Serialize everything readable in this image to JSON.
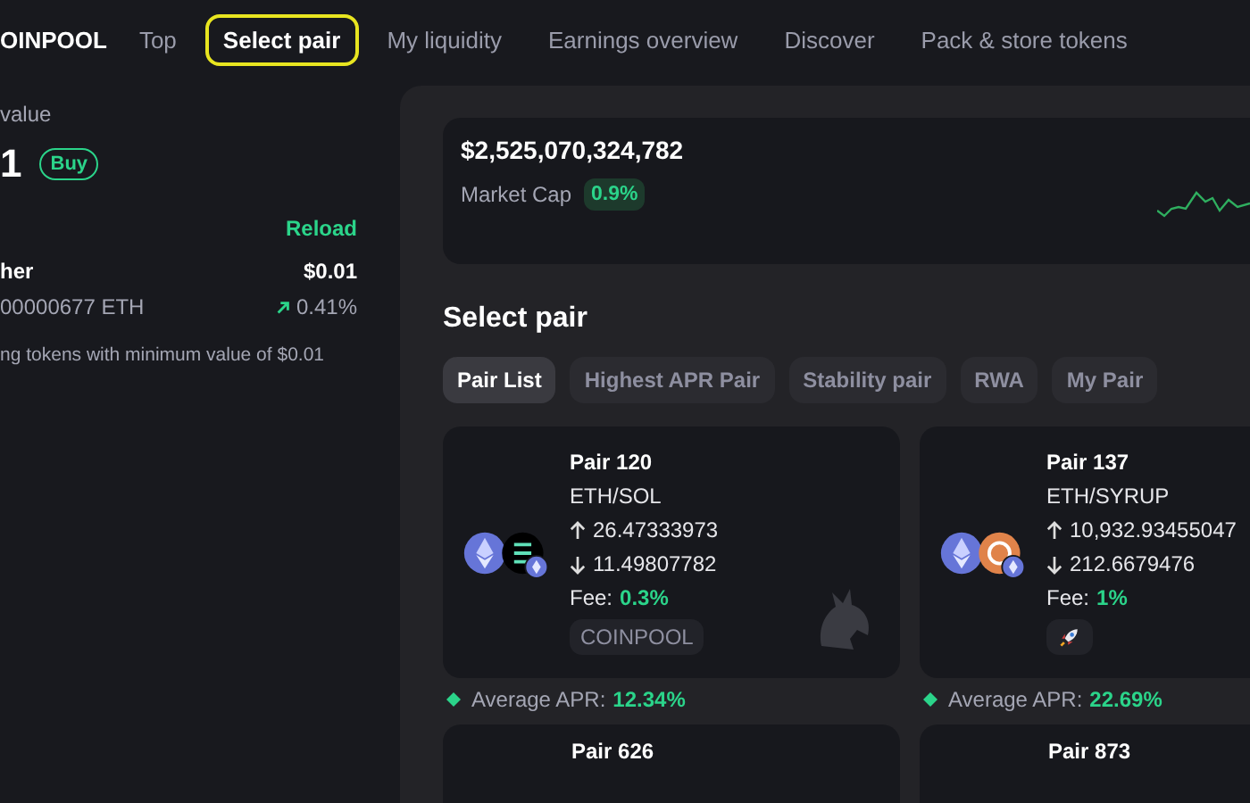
{
  "nav": {
    "logo": "OINPOOL",
    "items": [
      {
        "label": "Top",
        "selected": false
      },
      {
        "label": "Select pair",
        "selected": true
      },
      {
        "label": "My liquidity",
        "selected": false
      },
      {
        "label": "Earnings overview",
        "selected": false
      },
      {
        "label": "Discover",
        "selected": false
      },
      {
        "label": "Pack & store tokens",
        "selected": false
      }
    ]
  },
  "wallet": {
    "label": "value",
    "amount": "1",
    "buy": "Buy",
    "reload": "Reload",
    "token_name": "her",
    "price": "$0.01",
    "balance": "00000677 ETH",
    "change": "0.41%",
    "note": "ng tokens with minimum value of $0.01"
  },
  "market": {
    "value": "$2,525,070,324,782",
    "label": "Market Cap",
    "change": "0.9%"
  },
  "section_title": "Select pair",
  "filters": [
    {
      "label": "Pair List",
      "selected": true
    },
    {
      "label": "Highest APR Pair",
      "selected": false
    },
    {
      "label": "Stability pair",
      "selected": false
    },
    {
      "label": "RWA",
      "selected": false
    },
    {
      "label": "My Pair",
      "selected": false
    }
  ],
  "pairs": [
    {
      "name": "Pair 120",
      "symbol": "ETH/SOL",
      "up": "26.47333973",
      "down": "11.49807782",
      "fee_label": "Fee:",
      "fee": "0.3%",
      "tokens": [
        {
          "kind": "eth"
        },
        {
          "kind": "sol"
        }
      ],
      "tag": {
        "kind": "text",
        "text": "COINPOOL"
      },
      "dex_logo": true,
      "apr_label": "Average APR:",
      "apr": "12.34%"
    },
    {
      "name": "Pair 137",
      "symbol": "ETH/SYRUP",
      "up": "10,932.93455047",
      "down": "212.6679476",
      "fee_label": "Fee:",
      "fee": "1%",
      "tokens": [
        {
          "kind": "eth"
        },
        {
          "kind": "syrup"
        }
      ],
      "tag": {
        "kind": "rocket"
      },
      "dex_logo": false,
      "apr_label": "Average APR:",
      "apr": "22.69%"
    }
  ],
  "more_pairs": [
    "Pair 626",
    "Pair 873"
  ]
}
